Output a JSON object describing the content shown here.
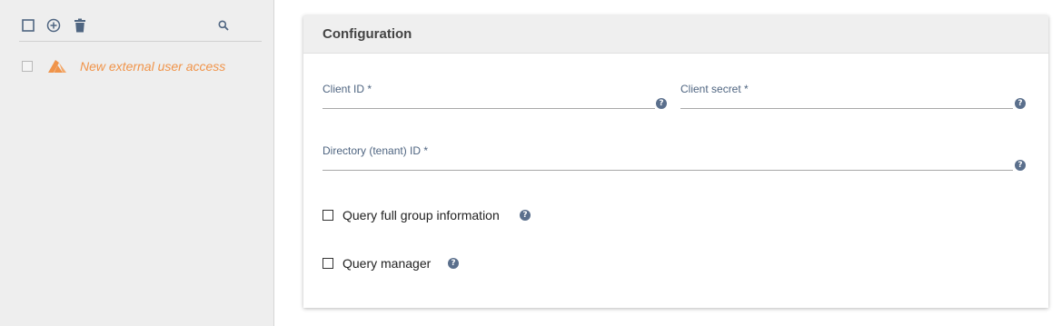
{
  "sidebar": {
    "toolbar": {
      "select_all_icon": "checkbox-icon",
      "add_icon": "plus-circle-icon",
      "delete_icon": "trash-icon",
      "search_icon": "search-icon"
    },
    "items": [
      {
        "label": "New external user access",
        "icon": "azure-icon",
        "color": "#f0944a"
      }
    ]
  },
  "config": {
    "title": "Configuration",
    "fields": {
      "client_id": {
        "label": "Client ID *",
        "value": ""
      },
      "client_secret": {
        "label": "Client secret *",
        "value": ""
      },
      "tenant_id": {
        "label": "Directory (tenant) ID *",
        "value": ""
      }
    },
    "checkboxes": {
      "full_group": {
        "label": "Query full group information",
        "checked": false
      },
      "manager": {
        "label": "Query manager",
        "checked": false
      }
    },
    "help_glyph": "?"
  },
  "colors": {
    "accent_orange": "#f0944a",
    "icon_blue": "#5a6f8c",
    "label_blue": "#4f6581"
  }
}
